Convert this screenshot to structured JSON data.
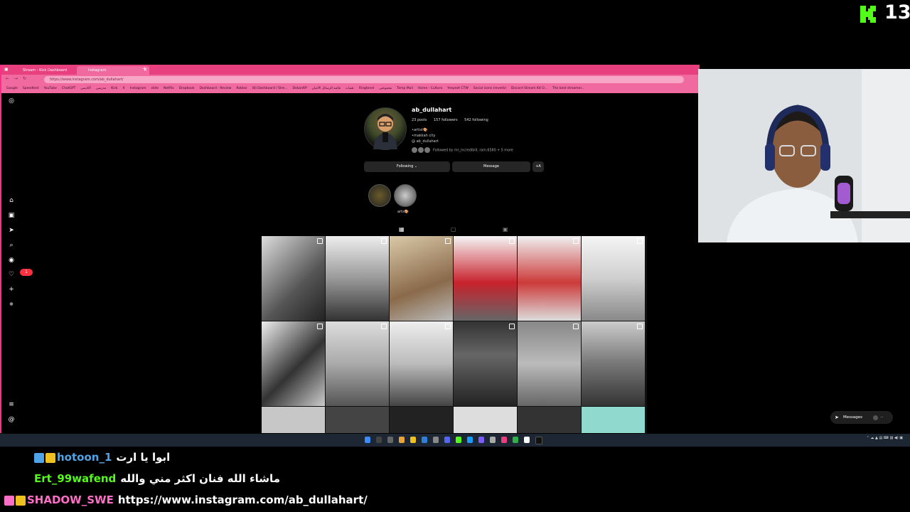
{
  "overlay": {
    "kick_count": "13",
    "brand_color": "#53fc18"
  },
  "browser": {
    "tabs": [
      {
        "label": "Stream - Kick Dashboard"
      },
      {
        "label": "Instagram"
      }
    ],
    "url": "https://www.instagram.com/ab_dullahart/",
    "bookmarks": [
      "Google",
      "Speedtest",
      "YouTube",
      "ChatGPT",
      "أكاديمي",
      "مدرسي",
      "Kick",
      "X",
      "Instagram",
      "slide",
      "Netflix",
      "Dropbook",
      "Dashboard - Review",
      "Roblox",
      "(8) Dashboard / Stre...",
      "DekanRP",
      "قائمة الرسائل الأحيان",
      "تقنيات",
      "Ringtonel",
      "مجموعتي",
      "Temp Mail",
      "Home - Cultura",
      "Yeepeet CTW",
      "Social icons (reverb)",
      "Discord Stream Kit O...",
      "The best streamer..."
    ],
    "accent_color": "#e8407f"
  },
  "instagram": {
    "username": "ab_dullahart",
    "stats": {
      "posts": "23 posts",
      "followers": "157 followers",
      "following": "542 following"
    },
    "bio": [
      "•artist🎨",
      "•makkah city",
      "@ ab_dullahart"
    ],
    "followed_by": "Followed by mr_incredibill, ram.6580 + 5 more",
    "buttons": {
      "following": "Following ⌄",
      "message": "Message",
      "more": "+A"
    },
    "highlight_label": "arts🎨",
    "messages_label": "Messages",
    "notification_count": "1",
    "posts": [
      "drawing of black car engine bay",
      "BRABUS car drawing",
      "drawing of man in keffiyeh",
      "red Mazda photo",
      "red Mazda drawing in progress",
      "white Toyota Camry drawing",
      "car drawing sketch",
      "white Land Cruiser drawing",
      "white Land Cruiser drawing 2",
      "girl portrait drawing",
      "Squidward drawing",
      "man in flat cap drawing"
    ]
  },
  "chat": [
    {
      "user": "hotoon_1",
      "message": "ابوا يا ارت",
      "user_color": "#4fa3e8"
    },
    {
      "user": "Ert_99wafend",
      "message": "ماشاء الله فنان اكثر مني والله",
      "user_color": "#53fc18"
    },
    {
      "user": "SHADOW_SWE",
      "message": "https://www.instagram.com/ab_dullahart/",
      "user_color": "#ff6ec7"
    }
  ]
}
